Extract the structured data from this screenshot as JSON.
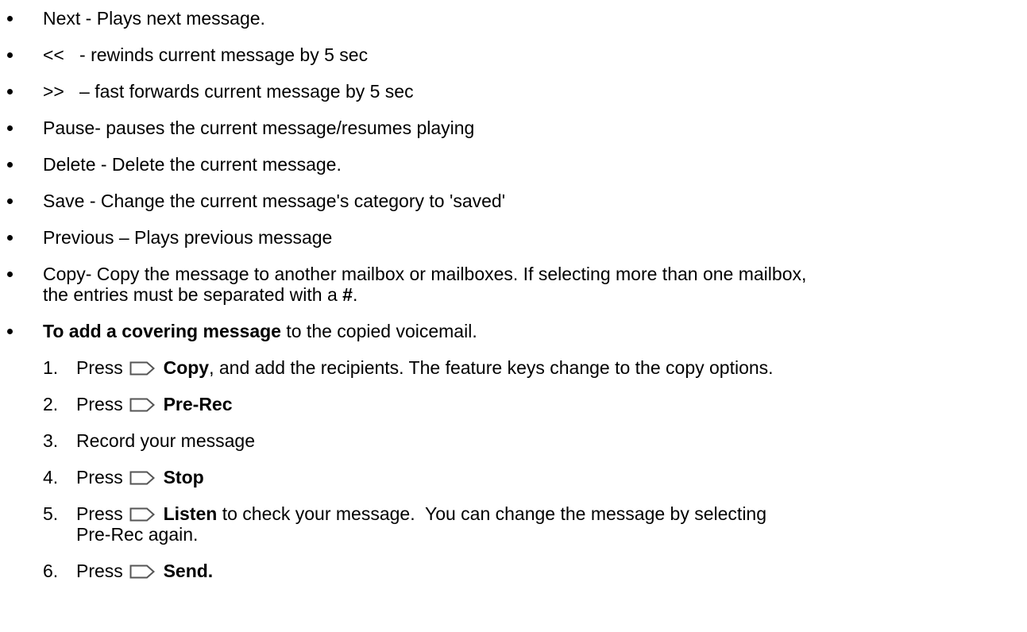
{
  "bullets": [
    {
      "text": "Next - Plays next message."
    },
    {
      "text": "<<   - rewinds current message by 5 sec"
    },
    {
      "text": ">>   – fast forwards current message by 5 sec"
    },
    {
      "text": "Pause- pauses the current message/resumes playing"
    },
    {
      "text": "Delete - Delete the current message."
    },
    {
      "text": "Save - Change the current message's category to 'saved'"
    },
    {
      "text": "Previous – Plays previous message"
    },
    {
      "text_line1": "Copy- Copy the message to another mailbox or mailboxes. If selecting more than one mailbox,",
      "text_line2": "the entries must be separated with a ",
      "bold_end": "#",
      "end": "."
    },
    {
      "bold": "To add a covering message",
      "text": " to the copied voicemail."
    }
  ],
  "steps": [
    {
      "num": "1.",
      "pre": "Press",
      "icon": "softkey-arrow-icon",
      "bold": "Copy",
      "post": ", and add the recipients. The feature keys change to the copy options."
    },
    {
      "num": "2.",
      "pre": "Press",
      "icon": "softkey-arrow-icon",
      "bold": "Pre-Rec",
      "post": ""
    },
    {
      "num": "3.",
      "pre": "Record your message"
    },
    {
      "num": "4.",
      "pre": "Press",
      "icon": "softkey-arrow-icon",
      "bold": "Stop",
      "post": ""
    },
    {
      "num": "5.",
      "pre": "Press",
      "icon": "softkey-arrow-icon",
      "bold": "Listen",
      "post": " to check your message.  You can change the message by selecting",
      "post_line2": "Pre-Rec again."
    },
    {
      "num": "6.",
      "pre": "Press",
      "icon": "softkey-arrow-icon",
      "bold": "Send."
    }
  ]
}
